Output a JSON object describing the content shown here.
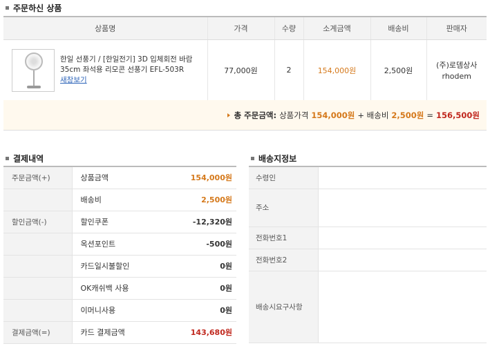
{
  "order_section": {
    "title": "주문하신 상품"
  },
  "order_table": {
    "headers": [
      "상품명",
      "가격",
      "수량",
      "소계금액",
      "배송비",
      "판매자"
    ],
    "row": {
      "product_name": "한일 선풍기 / [한일전기] 3D 입체회전 바람 35cm 좌석용 리모콘 선풍기 EFL-503R",
      "link_text": "새창보기",
      "price": "77,000원",
      "quantity": "2",
      "subtotal": "154,000원",
      "shipping": "2,500원",
      "seller_name": "(주)로뎀상사",
      "seller_id": "rhodem"
    }
  },
  "total_bar": {
    "label": "총 주문금액:",
    "product_price_label": "상품가격",
    "product_price": "154,000원",
    "plus": "+ 배송비",
    "shipping": "2,500원",
    "equals": "=",
    "total": "156,500원"
  },
  "payment_section": {
    "title": "결제내역"
  },
  "payment": {
    "rows": [
      {
        "category": "주문금액(+)",
        "item": "상품금액",
        "amount": "154,000원"
      },
      {
        "category": "",
        "item": "배송비",
        "amount": "2,500원"
      },
      {
        "category": "할인금액(-)",
        "item": "할인쿠폰",
        "amount": "-12,320원"
      },
      {
        "category": "",
        "item": "옥션포인트",
        "amount": "-500원"
      },
      {
        "category": "",
        "item": "카드일시불할인",
        "amount": "0원"
      },
      {
        "category": "",
        "item": "OK캐쉬백 사용",
        "amount": "0원"
      },
      {
        "category": "",
        "item": "이머니사용",
        "amount": "0원"
      },
      {
        "category": "결제금액(=)",
        "item": "카드 결제금액",
        "amount": "143,680원"
      }
    ]
  },
  "delivery_section": {
    "title": "배송지정보"
  },
  "delivery": {
    "labels": [
      "수령인",
      "주소",
      "전화번호1",
      "전화번호2",
      "배송시요구사항"
    ]
  },
  "colors": {
    "accent_orange": "#d5791b",
    "accent_red": "#c0281e"
  }
}
